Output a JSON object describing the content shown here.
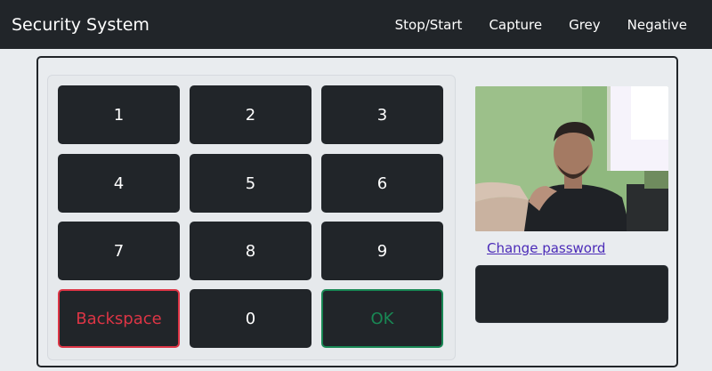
{
  "navbar": {
    "brand": "Security System",
    "links": [
      "Stop/Start",
      "Capture",
      "Grey",
      "Negative"
    ]
  },
  "keypad": {
    "keys": [
      "1",
      "2",
      "3",
      "4",
      "5",
      "6",
      "7",
      "8",
      "9",
      "Backspace",
      "0",
      "OK"
    ]
  },
  "sidebar": {
    "change_password": "Change password",
    "status_text": ""
  },
  "colors": {
    "dark": "#212529",
    "page_bg": "#e9ecef",
    "danger": "#dc3545",
    "success": "#198754",
    "link": "#4b2bb8"
  },
  "icons": {
    "camera_feed": "webcam-image"
  }
}
